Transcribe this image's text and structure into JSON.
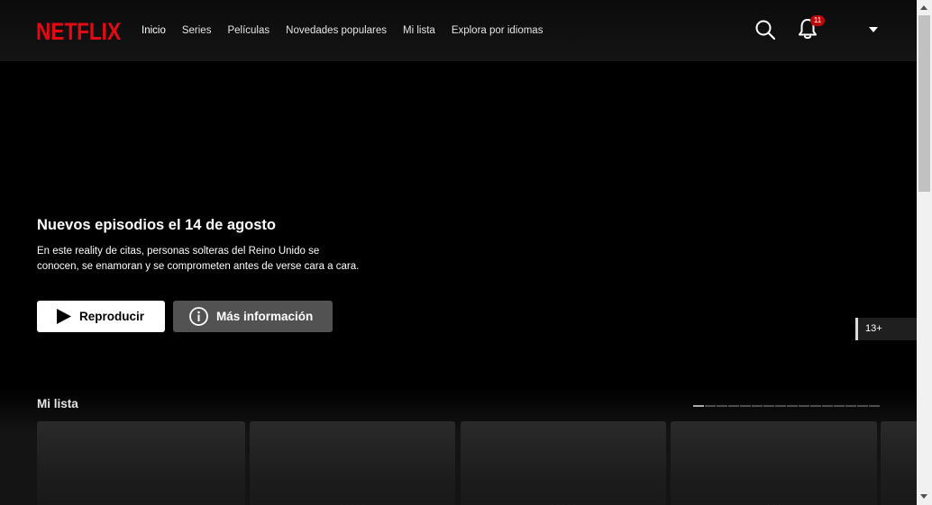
{
  "header": {
    "brand": "NETFLIX",
    "brand_color": "#E50914",
    "nav": [
      {
        "label": "Inicio",
        "active": true
      },
      {
        "label": "Series"
      },
      {
        "label": "Películas"
      },
      {
        "label": "Novedades populares"
      },
      {
        "label": "Mi lista"
      },
      {
        "label": "Explora por idiomas"
      }
    ],
    "search_icon": "search-icon",
    "notifications": {
      "icon": "bell-icon",
      "count": "11",
      "badge_color": "#B9090B"
    },
    "profile_menu_icon": "caret-down-icon"
  },
  "hero": {
    "title": "Nuevos episodios el 14 de agosto",
    "description": "En este reality de citas, personas solteras del Reino Unido se conocen, se enamoran y se comprometen antes de verse cara a cara.",
    "play_label": "Reproducir",
    "info_label": "Más información",
    "maturity_rating": "13+"
  },
  "row": {
    "title": "Mi lista",
    "pages": 16,
    "active_page": 1,
    "cards": [
      {
        "label": ""
      },
      {
        "label": "· · · · ·"
      },
      {
        "label": "· · · · ·"
      },
      {
        "label": "· · ·"
      },
      {
        "label": ""
      }
    ]
  }
}
